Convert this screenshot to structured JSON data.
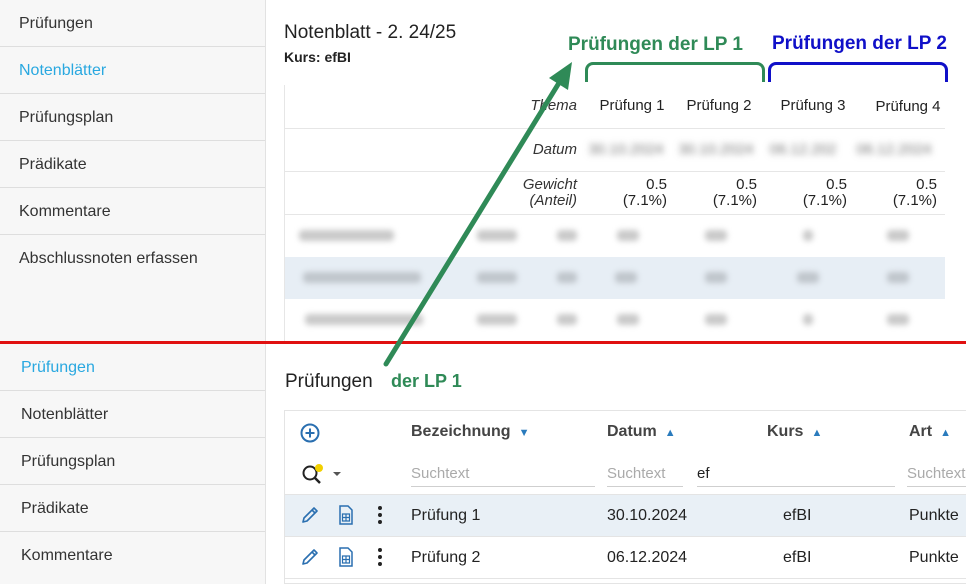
{
  "sidebar_top": {
    "items": [
      {
        "label": "Prüfungen",
        "active": false
      },
      {
        "label": "Notenblätter",
        "active": true
      },
      {
        "label": "Prüfungsplan",
        "active": false
      },
      {
        "label": "Prädikate",
        "active": false
      },
      {
        "label": "Kommentare",
        "active": false
      },
      {
        "label": "Abschlussnoten erfassen",
        "active": false
      }
    ]
  },
  "sidebar_bottom": {
    "items": [
      {
        "label": "Prüfungen",
        "active": true
      },
      {
        "label": "Notenblätter",
        "active": false
      },
      {
        "label": "Prüfungsplan",
        "active": false
      },
      {
        "label": "Prädikate",
        "active": false
      },
      {
        "label": "Kommentare",
        "active": false
      }
    ]
  },
  "notenblatt": {
    "title": "Notenblatt - 2. 24/25",
    "course": "Kurs: efBI",
    "row_labels": {
      "thema": "Thema",
      "datum": "Datum",
      "gewicht": "Gewicht",
      "anteil": "(Anteil)"
    },
    "exams": [
      {
        "name": "Prüfung 1",
        "date": "30.10.2024",
        "weight": "0.5",
        "share": "(7.1%)"
      },
      {
        "name": "Prüfung 2",
        "date": "30.10.2024",
        "weight": "0.5",
        "share": "(7.1%)"
      },
      {
        "name": "Prüfung 3",
        "date": "06.12.202",
        "weight": "0.5",
        "share": "(7.1%)"
      },
      {
        "name": "Prüfung 4",
        "date": "06.12.2024",
        "weight": "0.5",
        "share": "(7.1%)"
      }
    ]
  },
  "annotations": {
    "lp1": "Prüfungen der LP 1",
    "lp2": "Prüfungen der LP 2",
    "lp1_color": "#2f8a57",
    "lp2_color": "#1010c8",
    "arrow_color": "#2f8a57",
    "divider_color": "#e01010"
  },
  "pruefungen": {
    "title": "Prüfungen",
    "title_lp": "der LP 1",
    "columns": {
      "bezeichnung": "Bezeichnung",
      "datum": "Datum",
      "kurs": "Kurs",
      "art": "Art"
    },
    "filters": {
      "bezeichnung": "Suchtext",
      "datum": "Suchtext",
      "kurs": "ef",
      "art": "Suchtext"
    },
    "rows": [
      {
        "name": "Prüfung 1",
        "date": "30.10.2024",
        "course": "efBI",
        "type": "Punkte",
        "selected": true
      },
      {
        "name": "Prüfung 2",
        "date": "06.12.2024",
        "course": "efBI",
        "type": "Punkte",
        "selected": false
      }
    ],
    "icons": [
      "add-icon",
      "search-filter-icon",
      "edit-icon",
      "spreadsheet-icon",
      "more-vert-icon"
    ]
  }
}
